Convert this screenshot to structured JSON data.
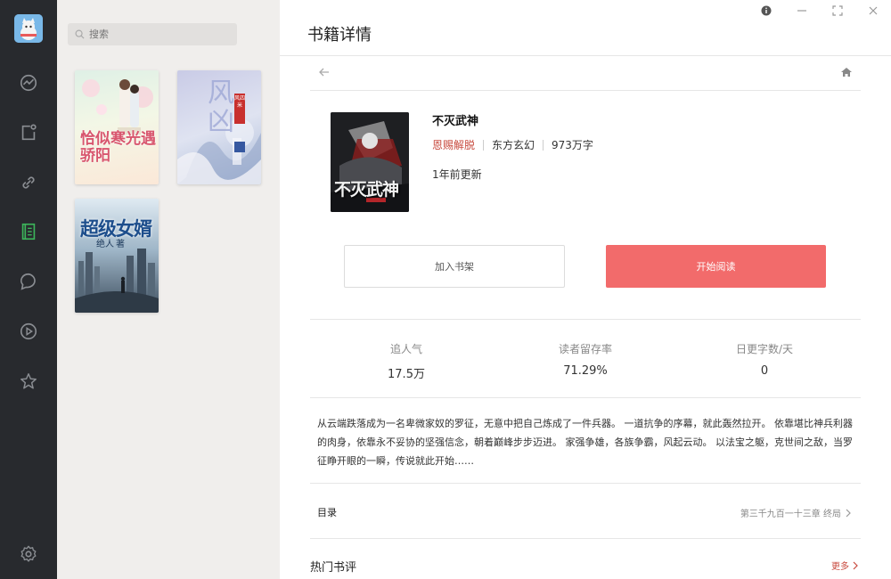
{
  "nav": {
    "items": [
      {
        "name": "discover",
        "icon": "trend-icon"
      },
      {
        "name": "tasks",
        "icon": "clipboard-icon"
      },
      {
        "name": "links",
        "icon": "link-icon"
      },
      {
        "name": "books",
        "icon": "book-icon",
        "active": true
      },
      {
        "name": "chat",
        "icon": "chat-icon"
      },
      {
        "name": "video",
        "icon": "play-icon"
      },
      {
        "name": "favorites",
        "icon": "star-icon"
      }
    ],
    "settings_icon": "gear-icon",
    "active_color": "#3cb45a"
  },
  "shelf": {
    "search_placeholder": "搜索",
    "books": [
      {
        "title": "恰似寒光遇骄阳"
      },
      {
        "title": "风凶",
        "sub": "风四米"
      },
      {
        "title": "超级女婿",
        "author": "绝人",
        "author_suffix": "著"
      }
    ]
  },
  "detail": {
    "page_title": "书籍详情",
    "book": {
      "title": "不灭武神",
      "cover_text": "不灭武神",
      "author": "恩赐解脱",
      "category": "东方玄幻",
      "word_count": "973万字",
      "updated": "1年前更新"
    },
    "buttons": {
      "add_to_shelf": "加入书架",
      "start_reading": "开始阅读"
    },
    "stats": [
      {
        "label": "追人气",
        "value": "17.5万"
      },
      {
        "label": "读者留存率",
        "value": "71.29%"
      },
      {
        "label": "日更字数/天",
        "value": "0"
      }
    ],
    "intro": "从云端跌落成为一名卑微家奴的罗征，无意中把自己炼成了一件兵器。 一道抗争的序幕，就此轰然拉开。 依靠堪比神兵利器的肉身，依靠永不妥协的坚强信念，朝着巅峰步步迈进。 家强争雄，各族争霸，风起云动。 以法宝之躯，克世间之敌，当罗征睁开眼的一瞬，传说就此开始……",
    "toc": {
      "label": "目录",
      "latest": "第三千九百一十三章 终局"
    },
    "reviews": {
      "label": "热门书评",
      "more": "更多"
    },
    "accent": "#f26b6b",
    "author_color": "#c84a3e"
  }
}
